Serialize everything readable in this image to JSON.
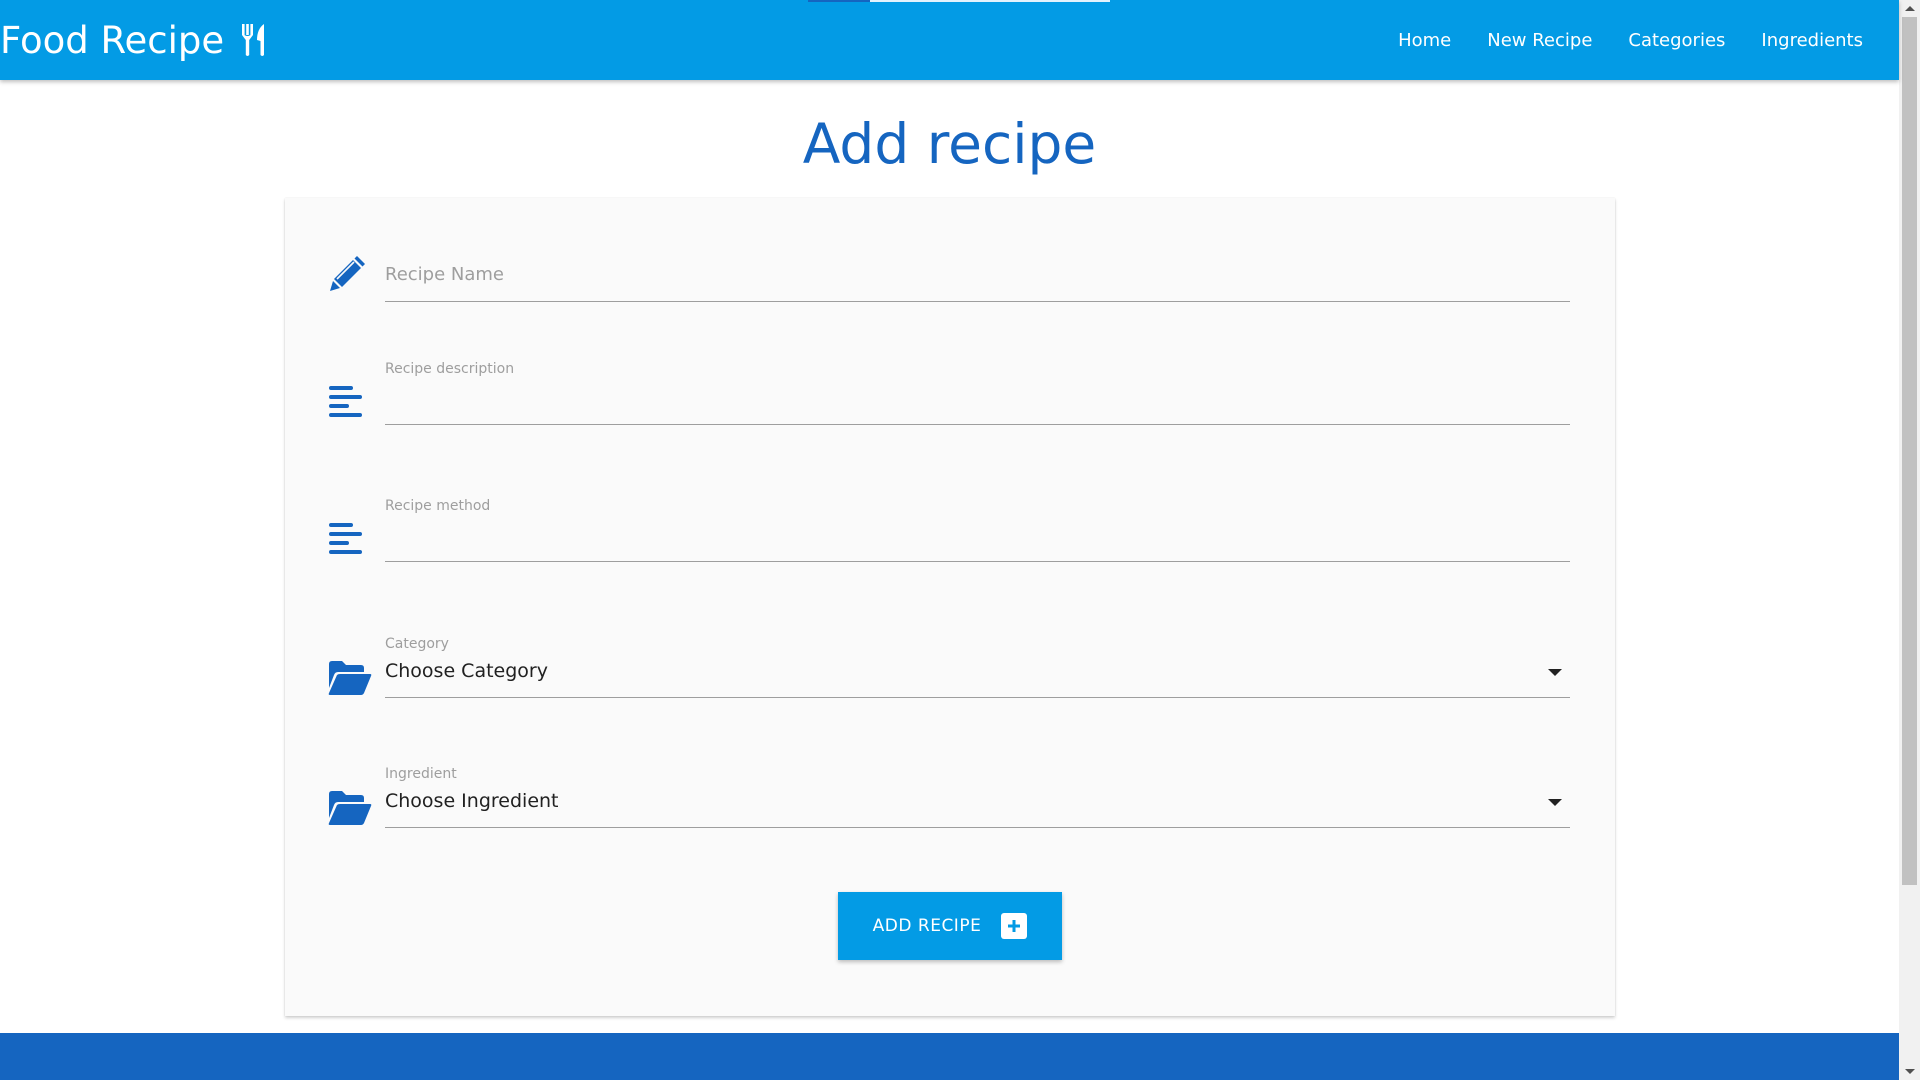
{
  "navbar": {
    "brand_title": "Food Recipe",
    "brand_icon": "utensils-icon",
    "links": [
      "Home",
      "New Recipe",
      "Categories",
      "Ingredients"
    ]
  },
  "page_title": "Add recipe",
  "form": {
    "recipe_name": {
      "placeholder": "Recipe Name",
      "value": "",
      "icon": "pencil-icon"
    },
    "recipe_description": {
      "label": "Recipe description",
      "value": "",
      "icon": "align-left-icon"
    },
    "recipe_method": {
      "label": "Recipe method",
      "value": "",
      "icon": "align-left-icon"
    },
    "category": {
      "label": "Category",
      "selected": "Choose Category",
      "icon": "folder-open-icon"
    },
    "ingredient": {
      "label": "Ingredient",
      "selected": "Choose Ingredient",
      "icon": "folder-open-icon"
    },
    "submit_label": "ADD RECIPE",
    "submit_icon": "plus-square-icon"
  },
  "colors": {
    "primary": "#039be5",
    "dark_primary": "#1565c0",
    "text": "#212121",
    "muted": "#9e9e9e"
  }
}
